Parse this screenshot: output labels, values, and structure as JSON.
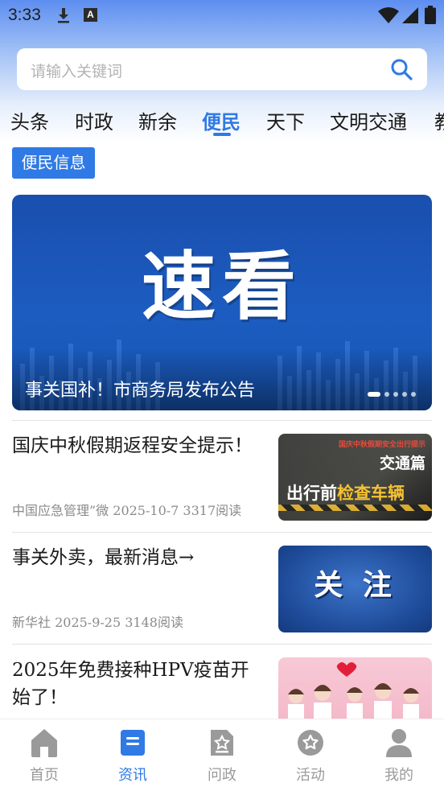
{
  "status_bar": {
    "time": "3:33",
    "notification_badge": "A"
  },
  "search": {
    "placeholder": "请输入关键词"
  },
  "tabs": [
    {
      "label": "头条"
    },
    {
      "label": "时政"
    },
    {
      "label": "新余"
    },
    {
      "label": "便民",
      "active": true
    },
    {
      "label": "天下"
    },
    {
      "label": "文明交通"
    },
    {
      "label": "教"
    }
  ],
  "section": {
    "badge": "便民信息"
  },
  "banner": {
    "image_text": "速看",
    "caption": "事关国补！市商务局发布公告",
    "slides": 5,
    "active_slide": 1
  },
  "news": [
    {
      "title": "国庆中秋假期返程安全提示！",
      "meta": "中国应急管理”微 2025-10-7   3317阅读",
      "thumb_texts": {
        "top": "国庆中秋假期安全出行提示",
        "mid": "交通篇",
        "main_a": "出行前",
        "main_b": "检查车辆"
      }
    },
    {
      "title": "事关外卖，最新消息→",
      "meta": "新华社  2025-9-25   3148阅读",
      "thumb_texts": {
        "main": "关 注"
      }
    },
    {
      "title": "2025年免费接种HPV疫苗开始了！",
      "meta": "",
      "thumb_texts": {}
    }
  ],
  "bottom_nav": [
    {
      "label": "首页",
      "icon": "home-icon"
    },
    {
      "label": "资讯",
      "icon": "news-icon",
      "active": true
    },
    {
      "label": "问政",
      "icon": "inquiry-icon"
    },
    {
      "label": "活动",
      "icon": "activity-icon"
    },
    {
      "label": "我的",
      "icon": "profile-icon"
    }
  ],
  "colors": {
    "accent": "#2f7ae5",
    "banner_bg": "#1c5cc0",
    "nav_inactive": "#9a9a9a"
  }
}
